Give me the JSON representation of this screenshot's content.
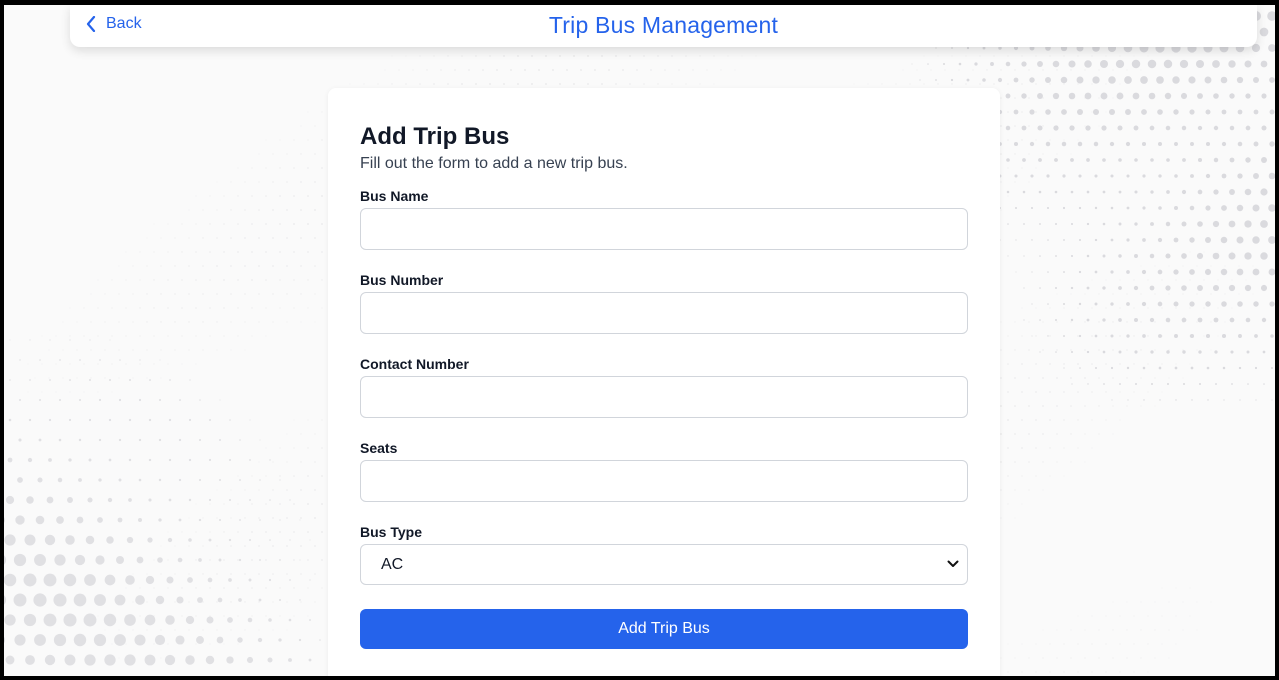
{
  "header": {
    "back_label": "Back",
    "title": "Trip Bus Management"
  },
  "form": {
    "title": "Add Trip Bus",
    "subtitle": "Fill out the form to add a new trip bus.",
    "fields": [
      {
        "label": "Bus Name",
        "value": "",
        "placeholder": ""
      },
      {
        "label": "Bus Number",
        "value": "",
        "placeholder": ""
      },
      {
        "label": "Contact Number",
        "value": "",
        "placeholder": ""
      },
      {
        "label": "Seats",
        "value": "",
        "placeholder": ""
      }
    ],
    "bus_type": {
      "label": "Bus Type",
      "selected": "AC"
    },
    "submit_label": "Add Trip Bus"
  },
  "colors": {
    "accent": "#2563eb",
    "background": "#fafafa",
    "card": "#ffffff"
  },
  "icons": {
    "back": "chevron-left-icon",
    "select": "chevron-down-icon"
  }
}
